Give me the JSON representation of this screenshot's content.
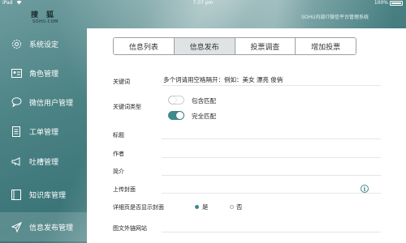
{
  "status_bar": {
    "carrier": "iPad",
    "time": "7:07 pm",
    "battery": "100%"
  },
  "header": {
    "logo_cn": "搜狐",
    "logo_en": "SOHU.COM",
    "system_title": "SOHU内部IT微信平台管理系统"
  },
  "sidebar": {
    "items": [
      {
        "label": "系统设定",
        "icon": "gear-icon"
      },
      {
        "label": "角色管理",
        "icon": "id-card-icon"
      },
      {
        "label": "微信用户管理",
        "icon": "chat-bubble-icon"
      },
      {
        "label": "工单管理",
        "icon": "document-icon"
      },
      {
        "label": "吐槽管理",
        "icon": "megaphone-icon"
      },
      {
        "label": "知识库管理",
        "icon": "book-icon"
      },
      {
        "label": "信息发布管理",
        "icon": "send-icon"
      }
    ],
    "active_index": 6
  },
  "tabs": [
    {
      "label": "信息列表"
    },
    {
      "label": "信息发布"
    },
    {
      "label": "投票调查"
    },
    {
      "label": "增加投票"
    }
  ],
  "active_tab": 1,
  "form": {
    "keyword_label": "关键词",
    "keyword_value": "多个词请用空格隔开：例如：美女 漂亮 俊俏",
    "keyword_type_label": "关键词类型",
    "match_contains_label": "包含匹配",
    "match_contains_on": false,
    "match_exact_label": "完全匹配",
    "match_exact_on": true,
    "title_label": "标题",
    "title_value": "",
    "author_label": "作者",
    "author_value": "",
    "summary_label": "简介",
    "summary_value": "",
    "cover_label": "上传封面",
    "cover_value": "",
    "show_cover_label": "详细页是否显示封面",
    "show_cover_yes": "是",
    "show_cover_no": "否",
    "show_cover_selected": "是",
    "link_label": "图文外链网站",
    "link_value": ""
  },
  "colors": {
    "accent": "#3f8a8c",
    "sidebar_bg": "#4d8486",
    "active_tab_bg": "#e0e3e4"
  }
}
